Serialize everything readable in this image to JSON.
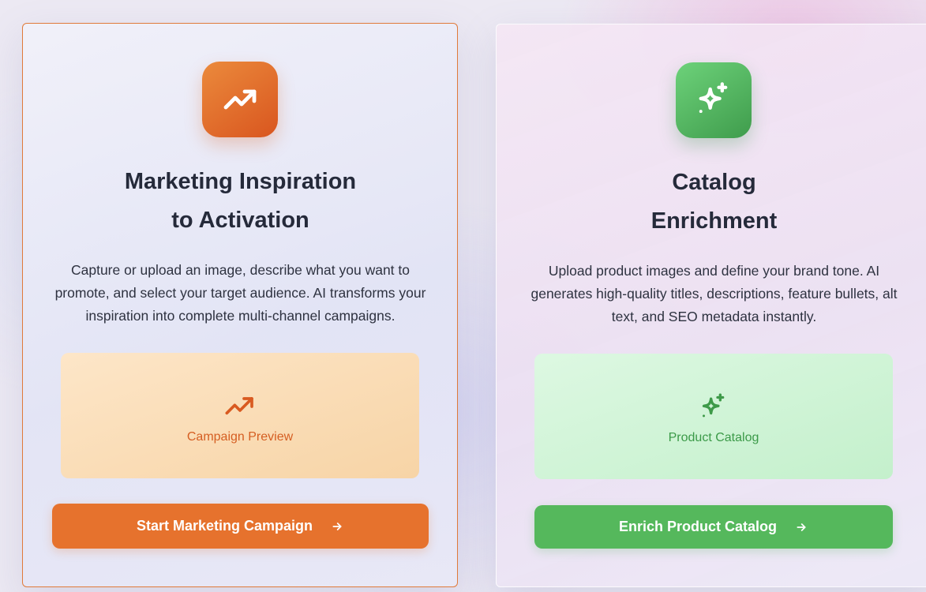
{
  "cards": [
    {
      "id": "marketing",
      "icon": "trending-up-icon",
      "title_line1": "Marketing Inspiration",
      "title_line2": "to Activation",
      "description": "Capture or upload an image, describe what you want to promote, and select your target audience. AI transforms your inspiration into complete multi-channel campaigns.",
      "preview_icon": "trending-up-icon",
      "preview_label": "Campaign Preview",
      "button_label": "Start Marketing Campaign",
      "button_icon": "arrow-right-icon",
      "accent_color": "#e6722d"
    },
    {
      "id": "catalog",
      "icon": "sparkles-icon",
      "title_line1": "Catalog",
      "title_line2": "Enrichment",
      "description": "Upload product images and define your brand tone. AI generates high-quality titles, descriptions, feature bullets, alt text, and SEO metadata instantly.",
      "preview_icon": "sparkles-icon",
      "preview_label": "Product Catalog",
      "button_label": "Enrich Product Catalog",
      "button_icon": "arrow-right-icon",
      "accent_color": "#55b85c"
    }
  ]
}
